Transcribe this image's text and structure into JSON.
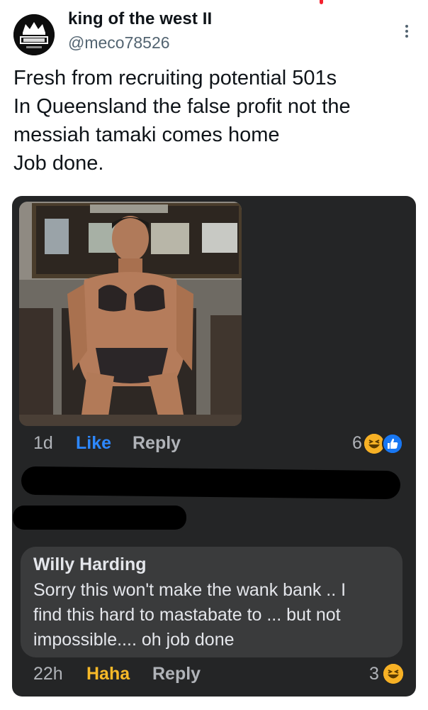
{
  "tweet": {
    "author": {
      "display_name": "king of the west II",
      "handle": "@meco78526",
      "avatar_icon": "crown-logo-avatar"
    },
    "more_icon": "more-vertical-icon",
    "text_lines": [
      "Fresh from recruiting potential 501s",
      "In Queensland the false profit not the",
      "messiah tamaki comes home",
      "Job done."
    ]
  },
  "screenshot": {
    "theme": "dark",
    "background": "#242526",
    "first_comment": {
      "time": "1d",
      "like_label": "Like",
      "reply_label": "Reply",
      "reaction_count": "6",
      "reaction_icons": [
        "haha-emoji-icon",
        "like-thumb-icon"
      ],
      "like_color": "#2d88ff"
    },
    "second_comment": {
      "author": "Willy Harding",
      "text_lines": [
        "Sorry this won't make the wank bank .. I",
        "find this hard to mastabate to ... but not",
        "impossible.... oh job done"
      ],
      "time": "22h",
      "haha_label": "Haha",
      "reply_label": "Reply",
      "reaction_count": "3",
      "reaction_icons": [
        "haha-emoji-icon"
      ],
      "haha_color": "#f7b928"
    }
  }
}
